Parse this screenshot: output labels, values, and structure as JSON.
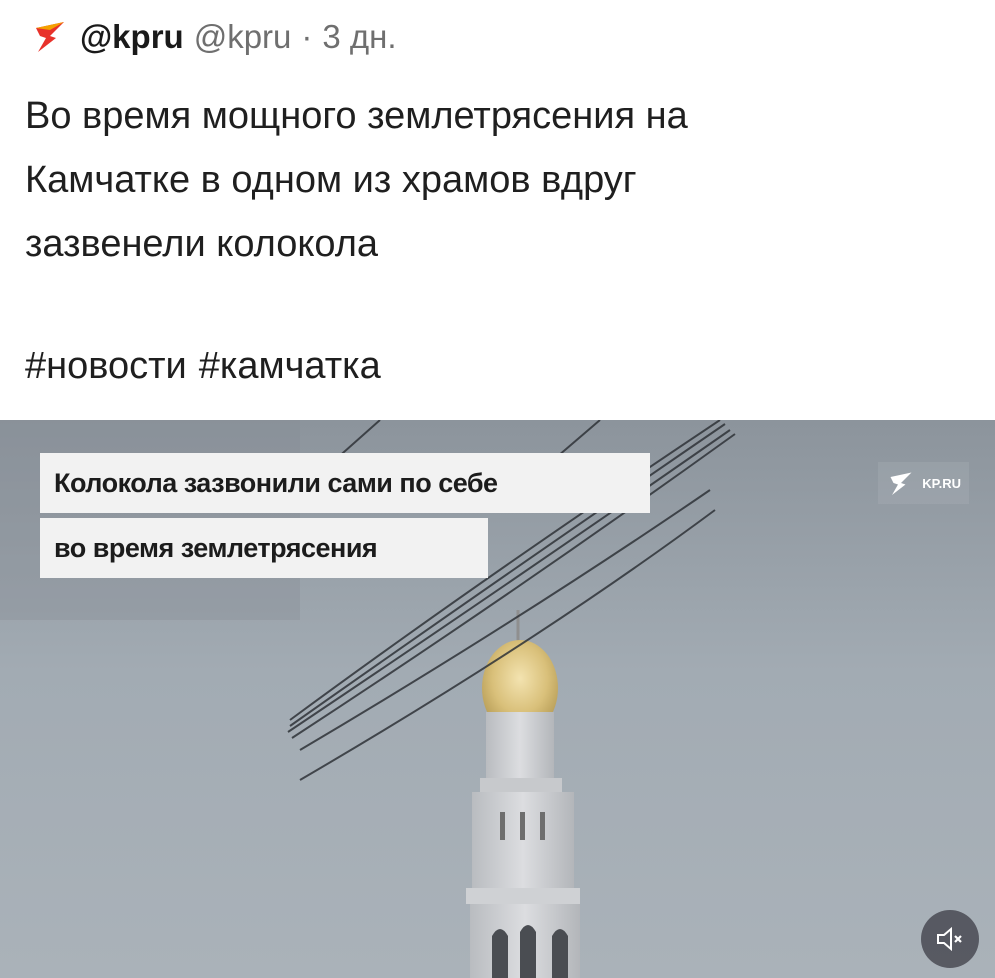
{
  "post": {
    "display_name": "@kpru",
    "handle": "@kpru",
    "separator": "·",
    "time": "3 дн.",
    "text": "Во время мощного землетрясения на\nКамчатке в одном из храмов вдруг\nзазвенели колокола",
    "hashtags": [
      "#новости",
      "#камчатка"
    ]
  },
  "video": {
    "caption_line1": "Колокола зазвонили сами по себе",
    "caption_line2": "во время землетрясения",
    "watermark": "KP.RU",
    "mute_icon": "volume-muted-icon"
  },
  "colors": {
    "brand_red": "#e8322b",
    "brand_yellow": "#f4a100",
    "sky": "#a2abb3"
  }
}
